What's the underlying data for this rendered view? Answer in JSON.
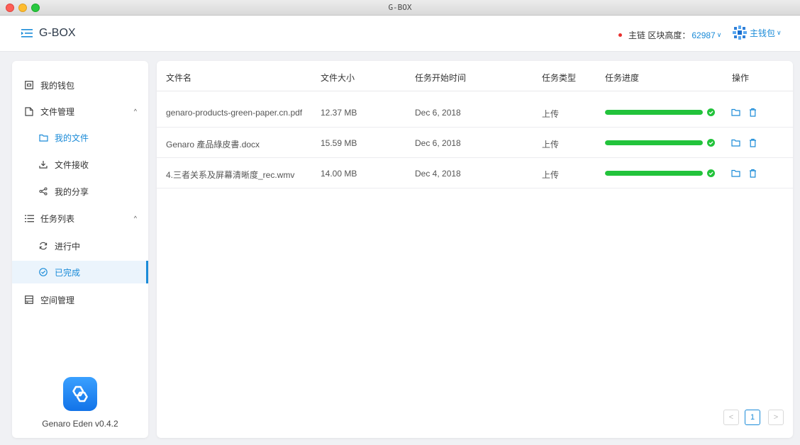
{
  "window": {
    "title": "G-BOX"
  },
  "header": {
    "app_title": "G-BOX",
    "chain_label": "主链 区块高度：",
    "block_height": "62987",
    "wallet_label": "主钱包"
  },
  "sidebar": {
    "items": [
      {
        "label": "我的钱包",
        "icon": "wallet-icon"
      },
      {
        "label": "文件管理",
        "icon": "file-icon",
        "expanded": true
      },
      {
        "label": "我的文件",
        "icon": "folder-icon"
      },
      {
        "label": "文件接收",
        "icon": "download-icon"
      },
      {
        "label": "我的分享",
        "icon": "share-icon"
      },
      {
        "label": "任务列表",
        "icon": "list-icon",
        "expanded": true
      },
      {
        "label": "进行中",
        "icon": "refresh-icon"
      },
      {
        "label": "已完成",
        "icon": "check-circle-icon",
        "active": true
      },
      {
        "label": "空间管理",
        "icon": "storage-icon"
      }
    ],
    "version": "Genaro Eden v0.4.2"
  },
  "table": {
    "headers": [
      "文件名",
      "文件大小",
      "任务开始时间",
      "任务类型",
      "任务进度",
      "操作"
    ],
    "rows": [
      {
        "name": "genaro-products-green-paper.cn.pdf",
        "size": "12.37 MB",
        "start": "Dec 6, 2018",
        "type": "上传",
        "progress": 100
      },
      {
        "name": "Genaro 產品綠皮書.docx",
        "size": "15.59 MB",
        "start": "Dec 6, 2018",
        "type": "上传",
        "progress": 100
      },
      {
        "name": "4.三者关系及屏幕清晰度_rec.wmv",
        "size": "14.00 MB",
        "start": "Dec 4, 2018",
        "type": "上传",
        "progress": 100
      }
    ]
  },
  "pagination": {
    "prev": "<",
    "current": "1",
    "next": ">"
  },
  "colors": {
    "accent": "#1a8bd8",
    "progress": "#22c33b",
    "status_dot": "#e8302e"
  }
}
